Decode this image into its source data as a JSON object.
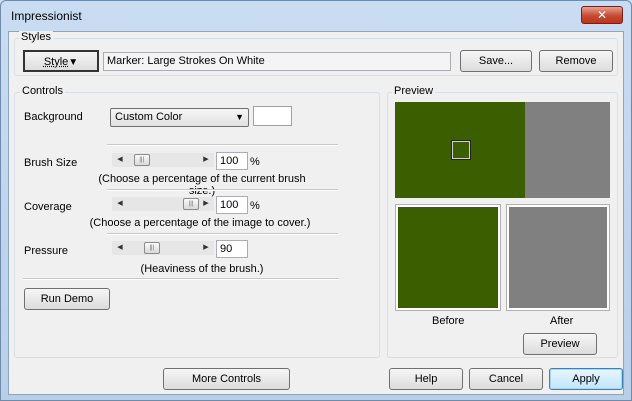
{
  "window": {
    "title": "Impressionist",
    "close_glyph": "✕"
  },
  "styles": {
    "group_label": "Styles",
    "style_button": "Style",
    "style_arrow": "▼",
    "current_style": "Marker: Large Strokes On White",
    "save_button": "Save...",
    "remove_button": "Remove"
  },
  "controls": {
    "group_label": "Controls",
    "background_label": "Background",
    "background_value": "Custom Color",
    "background_swatch_color": "#ffffff",
    "brush_size": {
      "label": "Brush Size",
      "value": "100",
      "unit": "%",
      "hint": "(Choose a percentage of the current brush size.)",
      "level": 0.12
    },
    "coverage": {
      "label": "Coverage",
      "value": "100",
      "unit": "%",
      "hint": "(Choose a percentage of the image to cover.)",
      "level": 1.0
    },
    "pressure": {
      "label": "Pressure",
      "value": "90",
      "hint": "(Heaviness of the brush.)",
      "level": 0.3
    },
    "run_demo_button": "Run Demo"
  },
  "preview": {
    "group_label": "Preview",
    "image_color": "#3a5e00",
    "before_label": "Before",
    "after_label": "After",
    "preview_button": "Preview"
  },
  "footer": {
    "more_controls_button": "More Controls",
    "help_button": "Help",
    "cancel_button": "Cancel",
    "apply_button": "Apply"
  }
}
